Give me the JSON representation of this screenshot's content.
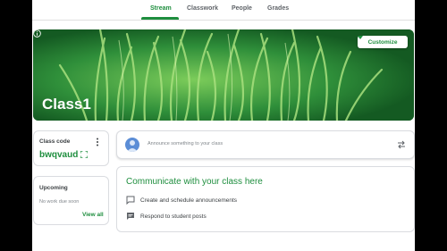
{
  "nav": {
    "tabs": [
      {
        "label": "Stream"
      },
      {
        "label": "Classwork"
      },
      {
        "label": "People"
      },
      {
        "label": "Grades"
      }
    ]
  },
  "banner": {
    "class_name": "Class1",
    "customize_label": "Customize"
  },
  "class_code": {
    "label": "Class code",
    "value": "bwqvaud"
  },
  "upcoming": {
    "title": "Upcoming",
    "empty": "No work due soon",
    "view_all": "View all"
  },
  "announce": {
    "placeholder": "Announce something to your class"
  },
  "communicate": {
    "title": "Communicate with your class here",
    "items": [
      {
        "label": "Create and schedule announcements",
        "icon": "announcement-icon"
      },
      {
        "label": "Respond to student posts",
        "icon": "comment-icon"
      }
    ]
  },
  "colors": {
    "accent": "#1e8e3e",
    "banner": "#1b6f2c"
  }
}
